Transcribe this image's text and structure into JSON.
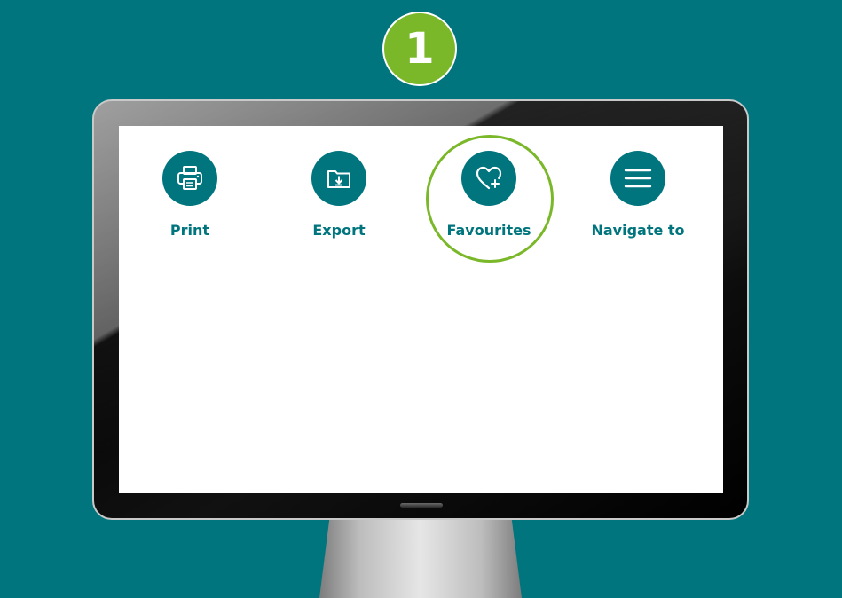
{
  "step": {
    "number": "1"
  },
  "menu": {
    "items": [
      {
        "label": "Print",
        "icon": "printer-icon"
      },
      {
        "label": "Export",
        "icon": "folder-download-icon"
      },
      {
        "label": "Favourites",
        "icon": "heart-plus-icon",
        "highlighted": true
      },
      {
        "label": "Navigate to",
        "icon": "hamburger-menu-icon"
      }
    ]
  },
  "colors": {
    "background": "#00757e",
    "accent": "#7ab829",
    "icon_fill": "#00757e",
    "label": "#00757e",
    "screen": "#ffffff"
  }
}
